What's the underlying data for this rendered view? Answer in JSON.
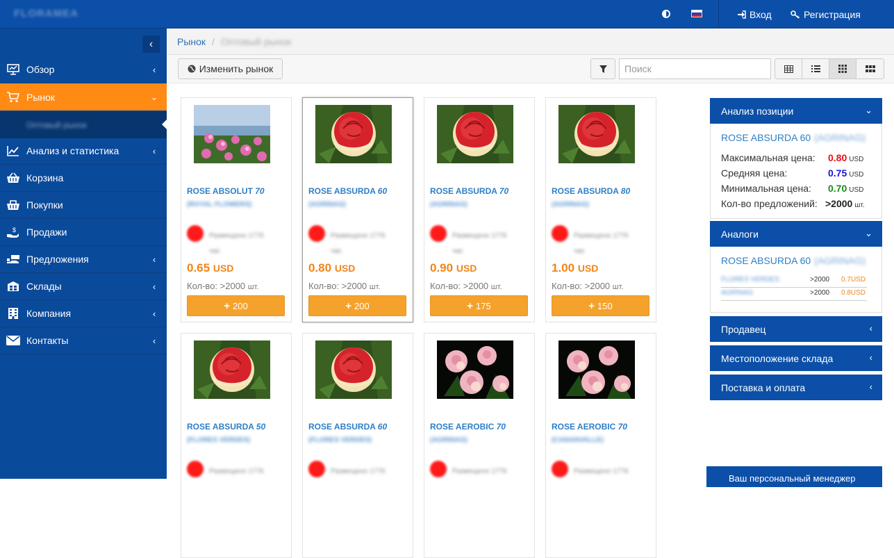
{
  "header": {
    "logo": "FLORAMEA",
    "login": "Вход",
    "register": "Регистрация"
  },
  "sidebar": {
    "items": [
      {
        "label": "Обзор",
        "icon": "presentation-icon",
        "chevron": "‹",
        "active": false
      },
      {
        "label": "Рынок",
        "icon": "cart-icon",
        "chevron": "⌄",
        "active": true
      },
      {
        "label": "Анализ и статистика",
        "icon": "chart-icon",
        "chevron": "‹",
        "active": false
      },
      {
        "label": "Корзина",
        "icon": "basket-icon",
        "chevron": "",
        "active": false
      },
      {
        "label": "Покупки",
        "icon": "shopping-icon",
        "chevron": "",
        "active": false
      },
      {
        "label": "Продажи",
        "icon": "money-hand-icon",
        "chevron": "",
        "active": false
      },
      {
        "label": "Предложения",
        "icon": "truck-icon",
        "chevron": "‹",
        "active": false
      },
      {
        "label": "Склады",
        "icon": "warehouse-icon",
        "chevron": "‹",
        "active": false
      },
      {
        "label": "Компания",
        "icon": "building-icon",
        "chevron": "‹",
        "active": false
      },
      {
        "label": "Контакты",
        "icon": "envelope-icon",
        "chevron": "‹",
        "active": false
      }
    ],
    "sub_item": "Оптовый рынок"
  },
  "breadcrumb": {
    "root": "Рынок",
    "current": "Оптовый рынок"
  },
  "toolbar": {
    "change_market": "Изменить рынок",
    "search_placeholder": "Поиск"
  },
  "products": [
    {
      "name": "ROSE ABSOLUT",
      "len": "70",
      "seller": "(ROYAL FLOWERS)",
      "placed": "Размещено 1776 час",
      "price": "0.65",
      "currency": "USD",
      "qty_label": "Кол-во: >2000",
      "unit": "шт.",
      "buy": "200",
      "img": "field"
    },
    {
      "name": "ROSE ABSURDA",
      "len": "60",
      "seller": "(AGRINAG)",
      "placed": "Размещено 1776 час",
      "price": "0.80",
      "currency": "USD",
      "qty_label": "Кол-во: >2000",
      "unit": "шт.",
      "buy": "200",
      "img": "red"
    },
    {
      "name": "ROSE ABSURDA",
      "len": "70",
      "seller": "(AGRINAG)",
      "placed": "Размещено 1776 час",
      "price": "0.90",
      "currency": "USD",
      "qty_label": "Кол-во: >2000",
      "unit": "шт.",
      "buy": "175",
      "img": "red"
    },
    {
      "name": "ROSE ABSURDA",
      "len": "80",
      "seller": "(AGRINAG)",
      "placed": "Размещено 1776 час",
      "price": "1.00",
      "currency": "USD",
      "qty_label": "Кол-во: >2000",
      "unit": "шт.",
      "buy": "150",
      "img": "red"
    },
    {
      "name": "ROSE ABSURDA",
      "len": "50",
      "seller": "(FLORES VERDES)",
      "placed": "Размещено 1776",
      "price": "",
      "currency": "",
      "qty_label": "",
      "unit": "",
      "buy": "",
      "img": "red"
    },
    {
      "name": "ROSE ABSURDA",
      "len": "60",
      "seller": "(FLORES VERDES)",
      "placed": "Размещено 1776",
      "price": "",
      "currency": "",
      "qty_label": "",
      "unit": "",
      "buy": "",
      "img": "red"
    },
    {
      "name": "ROSE AEROBIC",
      "len": "70",
      "seller": "(AGRINAG)",
      "placed": "Размещено 1776",
      "price": "",
      "currency": "",
      "qty_label": "",
      "unit": "",
      "buy": "",
      "img": "pink"
    },
    {
      "name": "ROSE AEROBIC",
      "len": "70",
      "seller": "(CANANVALLE)",
      "placed": "Размещено 1776",
      "price": "",
      "currency": "",
      "qty_label": "",
      "unit": "",
      "buy": "",
      "img": "pink"
    }
  ],
  "analysis": {
    "header": "Анализ позиции",
    "title": "ROSE ABSURDA 60",
    "title_seller": "(AGRINAG)",
    "max_label": "Максимальная цена:",
    "max_value": "0.80",
    "max_color": "#e8101a",
    "avg_label": "Средняя цена:",
    "avg_value": "0.75",
    "avg_color": "#1414d8",
    "min_label": "Минимальная цена:",
    "min_value": "0.70",
    "min_color": "#1a8a1a",
    "offers_label": "Кол-во предложений:",
    "offers_value": ">2000",
    "unit": "USD",
    "qty_unit": "шт."
  },
  "analogs": {
    "header": "Аналоги",
    "title": "ROSE ABSURDA 60",
    "title_seller": "(AGRINAG)",
    "rows": [
      {
        "name": "FLORES VERDES",
        "qty": ">2000",
        "price": "0.7USD"
      },
      {
        "name": "AGRINAG",
        "qty": ">2000",
        "price": "0.8USD"
      }
    ]
  },
  "panels": {
    "seller": "Продавец",
    "location": "Местоположение склада",
    "delivery": "Поставка и оплата"
  },
  "manager": "Ваш персональный менеджер",
  "colors": {
    "primary": "#0b4fa8",
    "accent": "#ff8a14",
    "price": "#f0851a",
    "link": "#2e7fc6"
  }
}
